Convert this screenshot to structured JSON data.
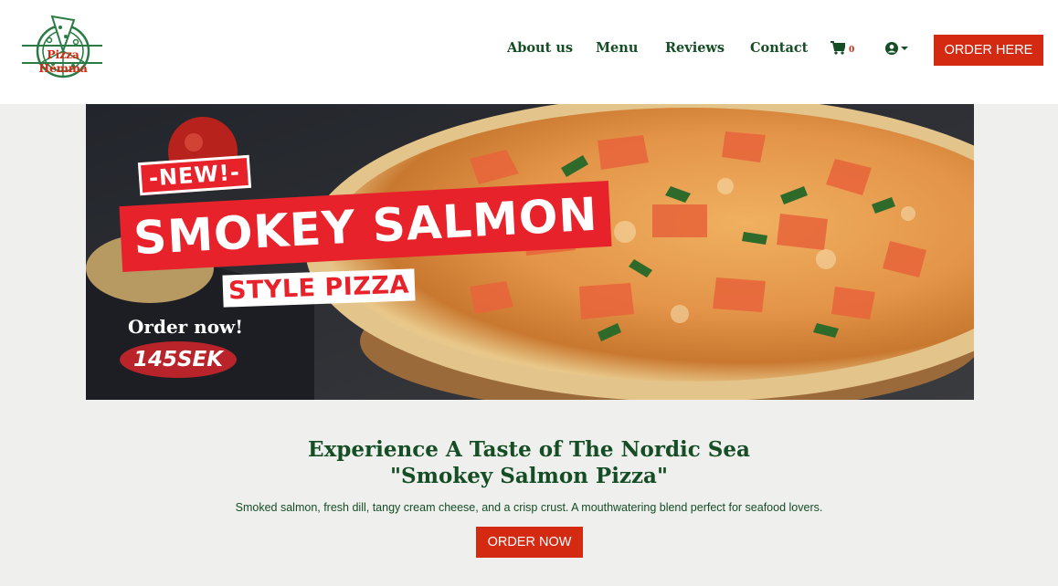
{
  "brand": {
    "name": "Pizza Hemma",
    "accent": "#d42a12",
    "green": "#154d25"
  },
  "nav": {
    "items": [
      {
        "label": "About us"
      },
      {
        "label": "Menu"
      },
      {
        "label": "Reviews"
      },
      {
        "label": "Contact"
      }
    ],
    "cart_icon": "shopping-cart-icon",
    "cart_count": "0",
    "user_icon": "user-circle-icon",
    "order_button": "ORDER HERE"
  },
  "hero": {
    "badge": "-NEW!-",
    "headline": "SMOKEY SALMON",
    "subheadline": "STYLE PIZZA",
    "cta_text": "Order now!",
    "price": "145SEK"
  },
  "content": {
    "title_line1": "Experience A Taste of The Nordic Sea",
    "title_line2": "\"Smokey Salmon Pizza\"",
    "description": "Smoked salmon, fresh dill, tangy cream cheese, and a crisp crust. A mouthwatering blend perfect for seafood lovers.",
    "order_button": "ORDER NOW"
  }
}
